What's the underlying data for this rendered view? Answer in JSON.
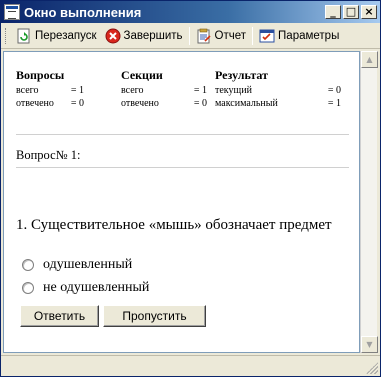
{
  "window": {
    "title": "Окно выполнения",
    "minimize": "_",
    "maximize": "□",
    "close": "×"
  },
  "toolbar": {
    "restart": "Перезапуск",
    "finish": "Завершить",
    "report": "Отчет",
    "params": "Параметры"
  },
  "stats": {
    "questions": {
      "header": "Вопросы",
      "rows": [
        {
          "label": "всего",
          "value": "= 1"
        },
        {
          "label": "отвечено",
          "value": "= 0"
        }
      ]
    },
    "sections": {
      "header": "Секции",
      "rows": [
        {
          "label": "всего",
          "value": "= 1"
        },
        {
          "label": "отвечено",
          "value": "= 0"
        }
      ]
    },
    "result": {
      "header": "Результат",
      "rows": [
        {
          "label": "текущий",
          "value": "= 0"
        },
        {
          "label": "максимальный",
          "value": "= 1"
        }
      ]
    }
  },
  "question": {
    "number_label": "Вопрос№ 1:",
    "text": "1. Существительное «мышь» обозначает предмет",
    "answers": [
      {
        "label": "одушевленный",
        "selected": false
      },
      {
        "label": "не одушевленный",
        "selected": false
      }
    ]
  },
  "buttons": {
    "answer": "Ответить",
    "skip": "Пропустить"
  },
  "colors": {
    "titlebar_start": "#0a246a",
    "titlebar_end": "#a6caf0",
    "window_bg": "#ece9d8"
  }
}
